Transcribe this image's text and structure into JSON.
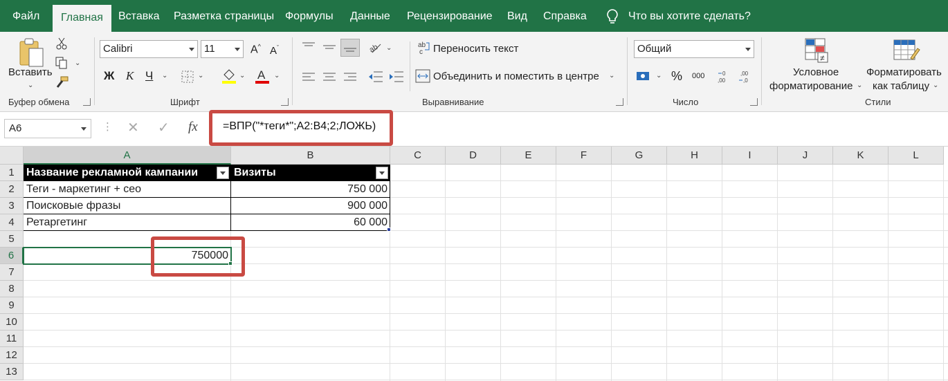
{
  "menu": {
    "tabs": [
      "Файл",
      "Главная",
      "Вставка",
      "Разметка страницы",
      "Формулы",
      "Данные",
      "Рецензирование",
      "Вид",
      "Справка"
    ],
    "active_tab": "Главная",
    "tell_me": "Что вы хотите сделать?"
  },
  "ribbon": {
    "clipboard": {
      "paste": "Вставить",
      "label": "Буфер обмена"
    },
    "font": {
      "family": "Calibri",
      "size": "11",
      "label": "Шрифт"
    },
    "alignment": {
      "wrap_text": "Переносить текст",
      "merge_center": "Объединить и поместить в центре",
      "label": "Выравнивание"
    },
    "number": {
      "format": "Общий",
      "label": "Число",
      "percent": "%",
      "thousands": "000"
    },
    "styles": {
      "conditional_1": "Условное",
      "conditional_2": "форматирование",
      "table_1": "Форматировать",
      "table_2": "как таблицу",
      "label": "Стили"
    }
  },
  "formula_bar": {
    "name_box": "A6",
    "fx": "fx",
    "formula": "=ВПР(\"*теги*\";A2:B4;2;ЛОЖЬ)"
  },
  "sheet": {
    "columns": [
      "A",
      "B",
      "C",
      "D",
      "E",
      "F",
      "G",
      "H",
      "I",
      "J",
      "K",
      "L"
    ],
    "rows": [
      "1",
      "2",
      "3",
      "4",
      "5",
      "6",
      "7",
      "8",
      "9",
      "10",
      "11",
      "12",
      "13"
    ],
    "table": {
      "headers": [
        "Название рекламной кампании",
        "Визиты"
      ],
      "rows": [
        [
          "Теги - маркетинг + сео",
          "750 000"
        ],
        [
          "Поисковые фразы",
          "900 000"
        ],
        [
          "Ретаргетинг",
          "60 000"
        ]
      ]
    },
    "result_cell": {
      "ref": "A6",
      "value": "750000"
    }
  },
  "colors": {
    "brand": "#217346",
    "highlight": "#c94a43"
  }
}
